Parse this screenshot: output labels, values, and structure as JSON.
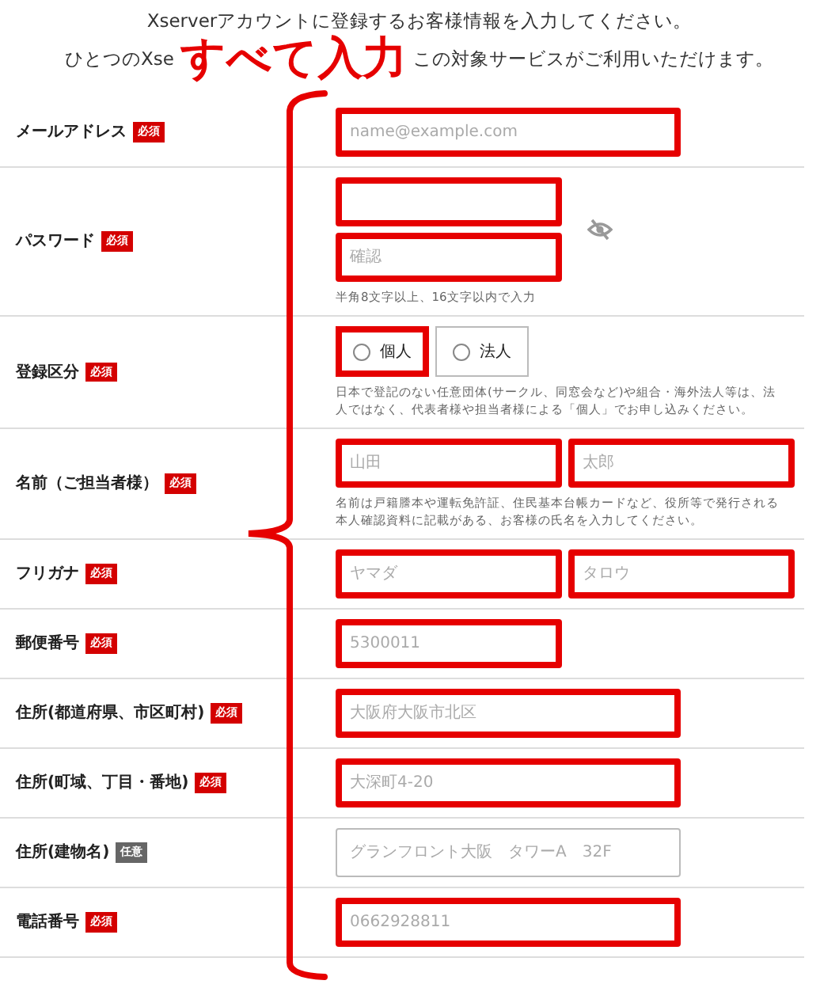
{
  "intro": {
    "line_1": "Xserverアカウントに登録するお客様情報を入力してください。",
    "line_2_start": "ひとつのXse",
    "line_2_end": "この対象サービスがご利用いただけます。"
  },
  "annotation": {
    "callout": "すべて入力"
  },
  "rows": [
    {
      "kind": "text",
      "label": "メールアドレス",
      "badge": "必須",
      "required": true,
      "fields": [
        {
          "placeholder": "name@example.com",
          "highlighted": true
        }
      ]
    },
    {
      "kind": "password",
      "label": "パスワード",
      "badge": "必須",
      "required": true,
      "fields": [
        {
          "highlighted": true
        },
        {
          "placeholder": "確認",
          "highlighted": true
        }
      ],
      "note": "半角8文字以上、16文字以内で入力"
    },
    {
      "kind": "radio",
      "label": "登録区分",
      "badge": "必須",
      "required": true,
      "options": [
        {
          "label": "個人",
          "selected": false,
          "highlighted": true
        },
        {
          "label": "法人",
          "selected": false,
          "highlighted": false
        }
      ],
      "note": "日本で登記のない任意団体(サークル、同窓会など)や組合・海外法人等は、法人ではなく、代表者様や担当者様による「個人」でお申し込みください。"
    },
    {
      "kind": "pair",
      "label": "名前（ご担当者様）",
      "badge": "必須",
      "required": true,
      "fields": [
        {
          "placeholder": "山田",
          "highlighted": true
        },
        {
          "placeholder": "太郎",
          "highlighted": true
        }
      ],
      "note": "名前は戸籍謄本や運転免許証、住民基本台帳カードなど、役所等で発行される本人確認資料に記載がある、お客様の氏名を入力してください。"
    },
    {
      "kind": "pair",
      "label": "フリガナ",
      "badge": "必須",
      "required": true,
      "fields": [
        {
          "placeholder": "ヤマダ",
          "highlighted": true
        },
        {
          "placeholder": "タロウ",
          "highlighted": true
        }
      ]
    },
    {
      "kind": "short",
      "label": "郵便番号",
      "badge": "必須",
      "required": true,
      "fields": [
        {
          "placeholder": "5300011",
          "highlighted": true
        }
      ]
    },
    {
      "kind": "text",
      "label": "住所(都道府県、市区町村)",
      "badge": "必須",
      "required": true,
      "fields": [
        {
          "placeholder": "大阪府大阪市北区",
          "highlighted": true
        }
      ]
    },
    {
      "kind": "text",
      "label": "住所(町域、丁目・番地)",
      "badge": "必須",
      "required": true,
      "fields": [
        {
          "placeholder": "大深町4-20",
          "highlighted": true
        }
      ]
    },
    {
      "kind": "text",
      "label": "住所(建物名)",
      "badge": "任意",
      "required": false,
      "fields": [
        {
          "placeholder": "グランフロント大阪　タワーA　32F",
          "highlighted": false
        }
      ]
    },
    {
      "kind": "text",
      "label": "電話番号",
      "badge": "必須",
      "required": true,
      "fields": [
        {
          "placeholder": "0662928811",
          "highlighted": true
        }
      ]
    }
  ]
}
